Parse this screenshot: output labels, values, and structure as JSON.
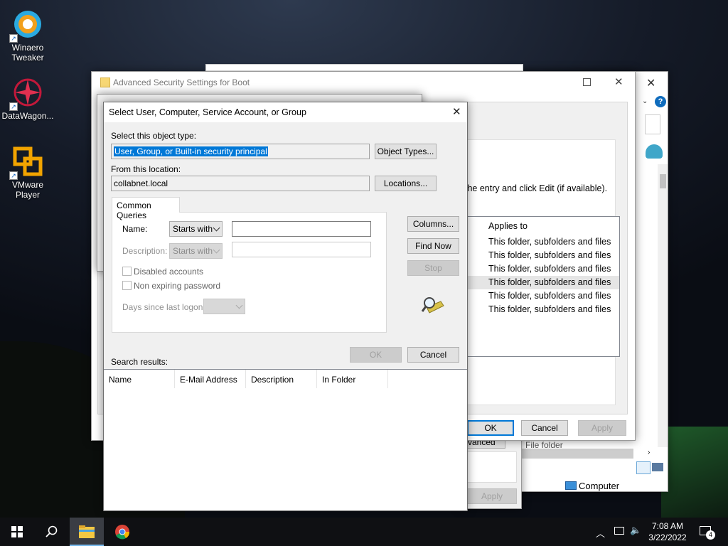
{
  "desktop": {
    "icons": [
      {
        "label": "Winaero Tweaker"
      },
      {
        "label": "DataWagon..."
      },
      {
        "label": "VMware Player"
      }
    ]
  },
  "adv_security": {
    "title": "Advanced Security Settings for Boot",
    "instruction": "the entry and click Edit (if available).",
    "applies_header": "Applies to",
    "applies_rows": [
      "This folder, subfolders and files",
      "This folder, subfolders and files",
      "This folder, subfolders and files",
      "This folder, subfolders and files",
      "This folder, subfolders and files",
      "This folder, subfolders and files"
    ],
    "ok_label": "OK",
    "cancel_label": "Cancel",
    "apply_label": "Apply"
  },
  "props_dialog": {
    "advanced_label": "vanced",
    "apply_label": "Apply"
  },
  "explorer": {
    "file_folder_text": "File folder",
    "computer_label": "Computer"
  },
  "select_dialog": {
    "title": "Select User, Computer, Service Account, or Group",
    "object_type_label": "Select this object type:",
    "object_type_value": "User, Group, or Built-in security principal",
    "object_types_button": "Object Types...",
    "location_label": "From this location:",
    "location_value": "collabnet.local",
    "locations_button": "Locations...",
    "tab_label": "Common Queries",
    "name_label": "Name:",
    "name_mode": "Starts with",
    "description_label": "Description:",
    "description_mode": "Starts with",
    "disabled_accounts_label": "Disabled accounts",
    "non_expiring_label": "Non expiring password",
    "days_since_label": "Days since last logon:",
    "columns_button": "Columns...",
    "find_now_button": "Find Now",
    "stop_button": "Stop",
    "ok_button": "OK",
    "cancel_button": "Cancel",
    "search_results_label": "Search results:",
    "result_columns": [
      "Name",
      "E-Mail Address",
      "Description",
      "In Folder"
    ]
  },
  "taskbar": {
    "time": "7:08 AM",
    "date": "3/22/2022",
    "notification_count": "4"
  },
  "colors": {
    "accent": "#0078d7",
    "selection": "#0078d7"
  }
}
